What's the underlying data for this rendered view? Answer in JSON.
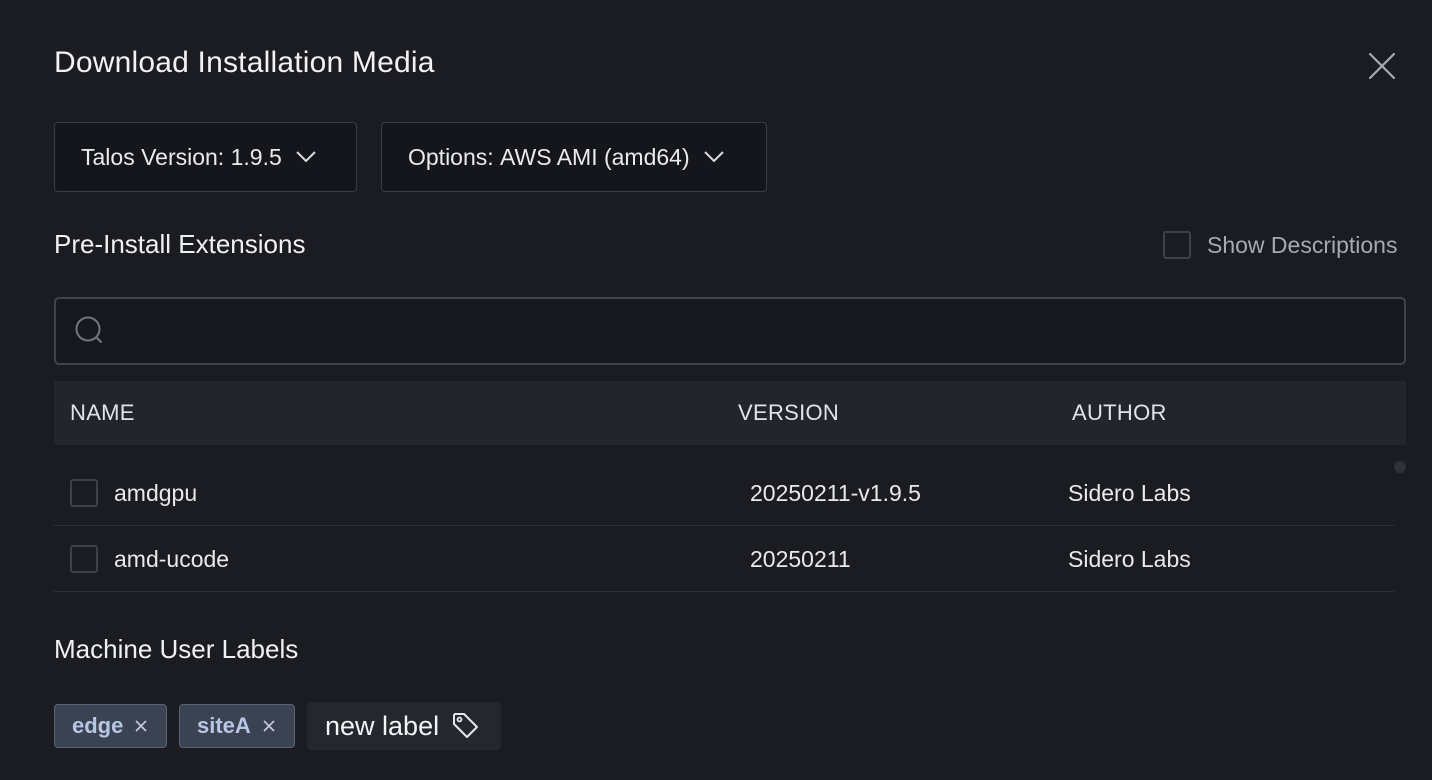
{
  "dialog": {
    "title": "Download Installation Media"
  },
  "controls": {
    "version_label": "Talos Version:",
    "version_value": "1.9.5",
    "options_label": "Options:",
    "options_value": "AWS AMI (amd64)"
  },
  "extensions": {
    "section_title": "Pre-Install Extensions",
    "show_descriptions_label": "Show Descriptions",
    "search": {
      "placeholder": "",
      "value": ""
    },
    "columns": {
      "name": "NAME",
      "version": "VERSION",
      "author": "AUTHOR"
    },
    "rows": [
      {
        "name": "amdgpu",
        "version": "20250211-v1.9.5",
        "author": "Sidero Labs",
        "checked": false
      },
      {
        "name": "amd-ucode",
        "version": "20250211",
        "author": "Sidero Labs",
        "checked": false
      }
    ]
  },
  "labels": {
    "section_title": "Machine User Labels",
    "tags": [
      "edge",
      "siteA"
    ],
    "new_label_text": "new label"
  },
  "icons": {
    "close": "close-icon",
    "chevron": "chevron-down-icon",
    "search": "search-icon",
    "remove": "close-icon",
    "tag": "tag-icon"
  },
  "colors": {
    "background": "#1b1c22",
    "tag_background": "#3b4252",
    "tag_text": "#b8c6e6"
  }
}
